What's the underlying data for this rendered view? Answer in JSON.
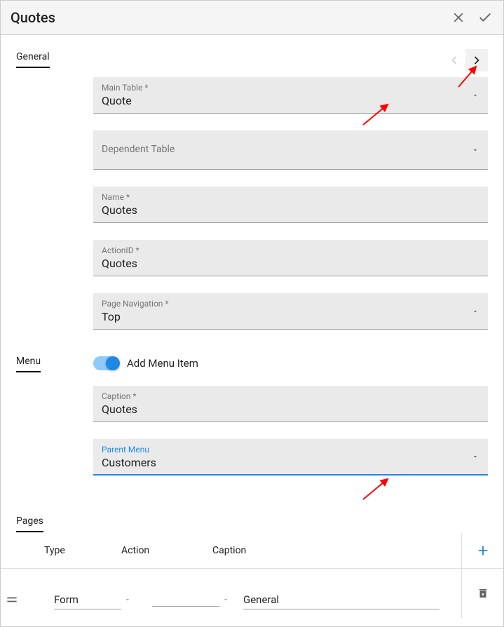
{
  "header": {
    "title": "Quotes"
  },
  "sections": {
    "general": {
      "label": "General"
    },
    "menu": {
      "label": "Menu",
      "toggle_label": "Add Menu Item"
    },
    "pages": {
      "label": "Pages"
    }
  },
  "fields": {
    "main_table": {
      "label": "Main Table *",
      "value": "Quote"
    },
    "dependent_table": {
      "label": "Dependent Table",
      "value": ""
    },
    "name": {
      "label": "Name *",
      "value": "Quotes"
    },
    "action_id": {
      "label": "ActionID *",
      "value": "Quotes"
    },
    "page_navigation": {
      "label": "Page Navigation *",
      "value": "Top"
    },
    "caption": {
      "label": "Caption *",
      "value": "Quotes"
    },
    "parent_menu": {
      "label": "Parent Menu",
      "value": "Customers"
    }
  },
  "pages_table": {
    "columns": {
      "type": "Type",
      "action": "Action",
      "caption": "Caption"
    },
    "rows": [
      {
        "type": "Form",
        "action": "",
        "caption": "General"
      }
    ]
  }
}
